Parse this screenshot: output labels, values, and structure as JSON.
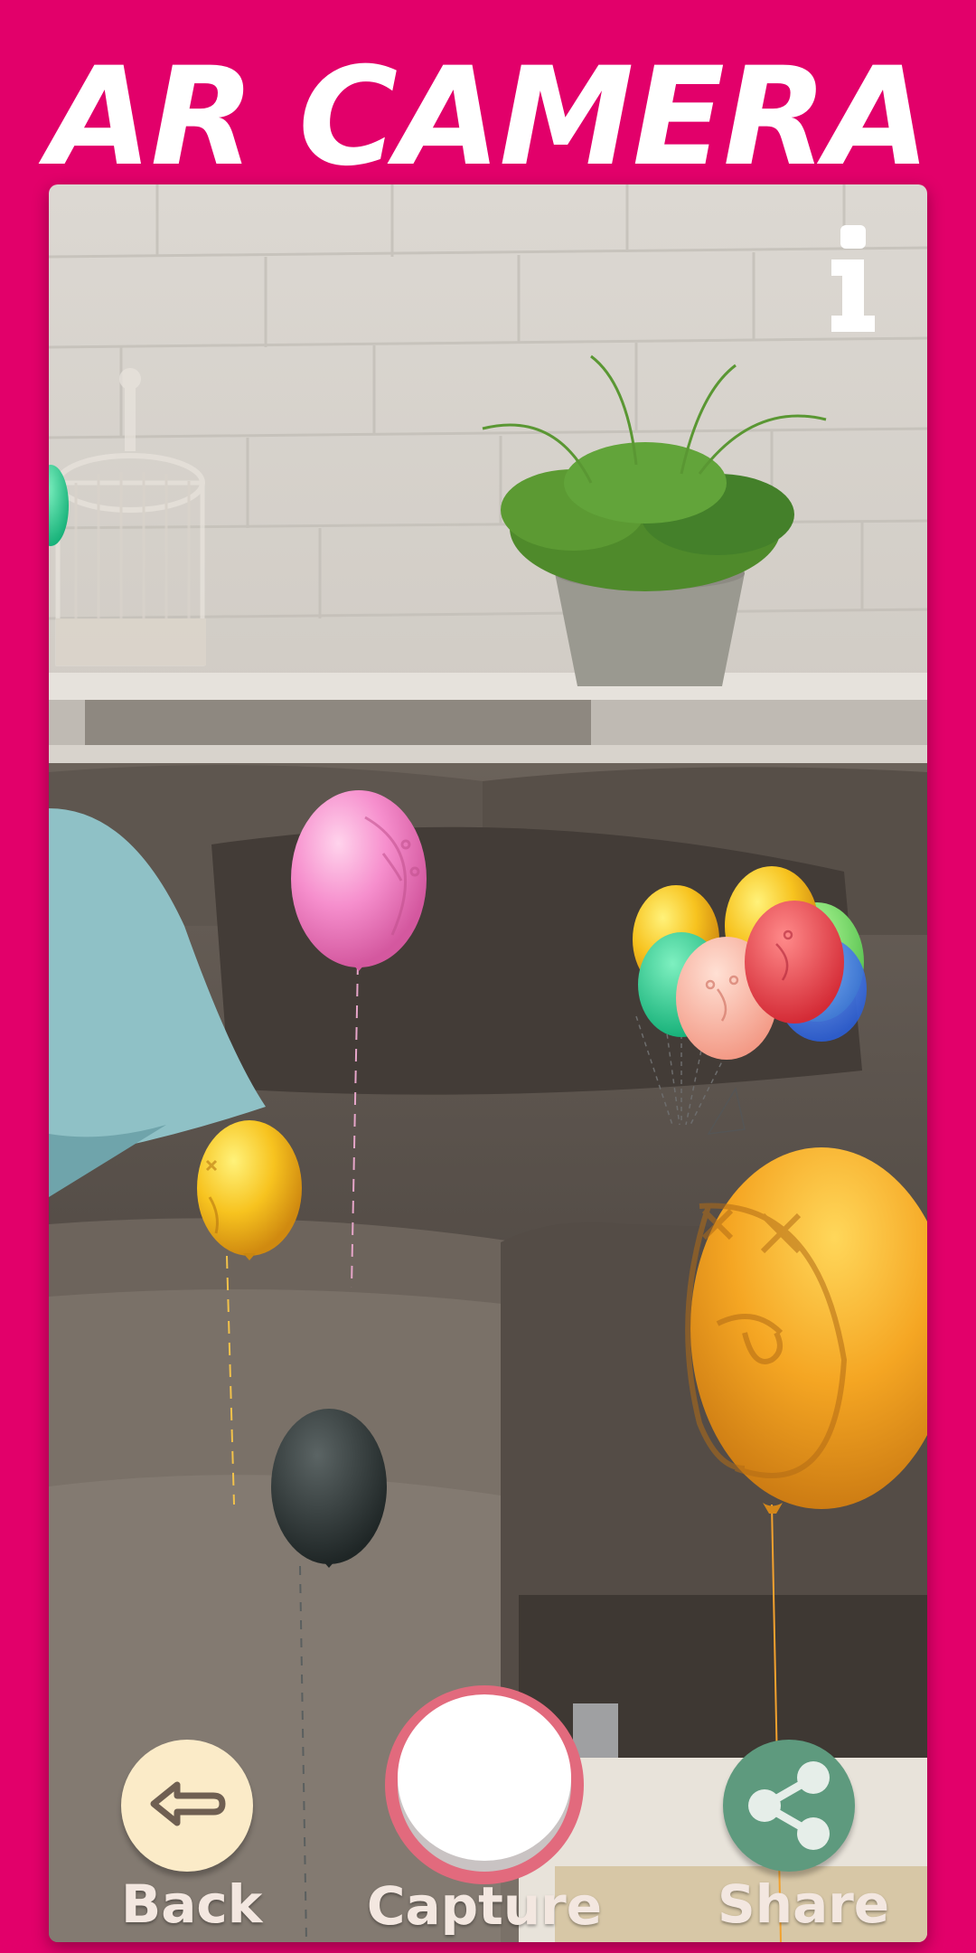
{
  "header": {
    "title": "AR Camera"
  },
  "controls": {
    "back_label": "Back",
    "capture_label": "Capture",
    "share_label": "Share"
  },
  "icons": {
    "info": "info-icon",
    "back": "arrow-left-icon",
    "share": "share-icon"
  },
  "colors": {
    "brand": "#E2006A",
    "back_button": "#FBEBC8",
    "share_button": "#5E9A7E",
    "capture_ring": "#E26A7D"
  }
}
